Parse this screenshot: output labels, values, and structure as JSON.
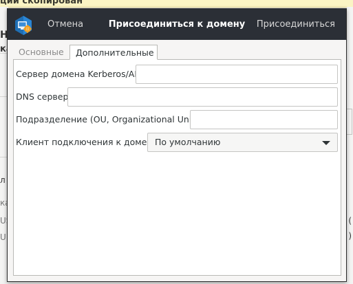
{
  "background": {
    "notification_text": "ции скопирован",
    "left_fragments": [
      "Н",
      "ка",
      "л с",
      "ка",
      "US",
      "U"
    ],
    "right_fragments": [
      "(",
      ")"
    ]
  },
  "dialog": {
    "title": "Присоединиться к домену",
    "cancel_label": "Отмена",
    "join_label": "Присоединиться",
    "app_icon": "domain-join-app-icon",
    "tabs": [
      {
        "label": "Основные",
        "active": false
      },
      {
        "label": "Дополнительные",
        "active": true
      }
    ],
    "fields": {
      "kerberos": {
        "label": "Сервер домена Kerberos/AD",
        "value": ""
      },
      "dns": {
        "label": "DNS сервер:",
        "value": ""
      },
      "ou": {
        "label": "Подразделение (OU, Organizational Unit):",
        "value": ""
      },
      "client": {
        "label": "Клиент подключения к домену",
        "selected": "По умолчанию"
      }
    }
  },
  "colors": {
    "header_bg": "#2b2f36",
    "notification_bg": "#fbf4c4"
  }
}
